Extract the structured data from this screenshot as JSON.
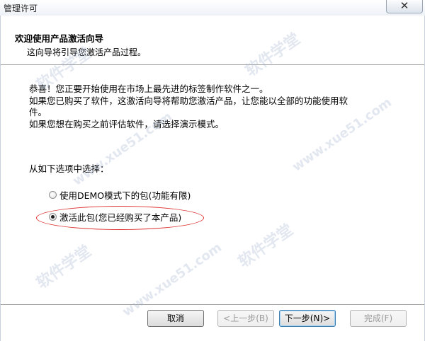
{
  "window": {
    "title": "管理许可",
    "close_glyph": "✕"
  },
  "header": {
    "title": "欢迎使用产品激活向导",
    "subtitle": "这向导将引导您激活产品过程。"
  },
  "body": {
    "lines": [
      "恭喜！您正要开始使用在市场上最先进的标签制作软件之一。",
      "如果您已购买了软件，这激活向导将帮助您激活产品，让您能以全部的功能使用软",
      "件。",
      "如果您想在购买之前评估软件，请选择演示模式。"
    ],
    "choose_label": "从如下选项中选择：",
    "options": [
      {
        "label": "使用DEMO模式下的包(功能有限)",
        "checked": false
      },
      {
        "label": "激活此包(您已经购买了本产品)",
        "checked": true
      }
    ]
  },
  "buttons": {
    "cancel": "取消",
    "back": "<上一步(B)",
    "next": "下一步(N)>",
    "finish": "完成(F)"
  },
  "watermark": {
    "texts": [
      "软件学堂",
      "www.xue51.com"
    ],
    "color": "#a0afcd"
  },
  "colors": {
    "highlight_ellipse": "#d33333",
    "separator": "#a0a0a0"
  }
}
